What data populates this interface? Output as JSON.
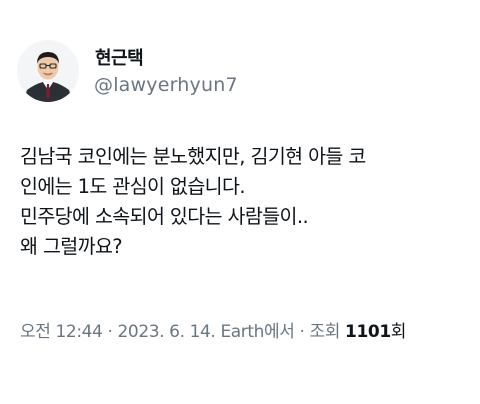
{
  "author": {
    "display_name": "현근택",
    "handle": "@lawyerhyun7"
  },
  "tweet": {
    "lines": [
      "김남국 코인에는 분노했지만, 김기현 아들 코",
      "인에는 1도 관심이 없습니다.",
      "민주당에 소속되어 있다는 사람들이..",
      "왜 그럴까요?"
    ]
  },
  "meta": {
    "time": "오전 12:44",
    "separator": " · ",
    "date": "2023. 6. 14.",
    "source": "Earth에서",
    "views_label": "조회",
    "views_count": "1101",
    "views_unit": "회"
  },
  "colors": {
    "text": "#0f1419",
    "muted": "#6b7680",
    "background": "#ffffff"
  }
}
